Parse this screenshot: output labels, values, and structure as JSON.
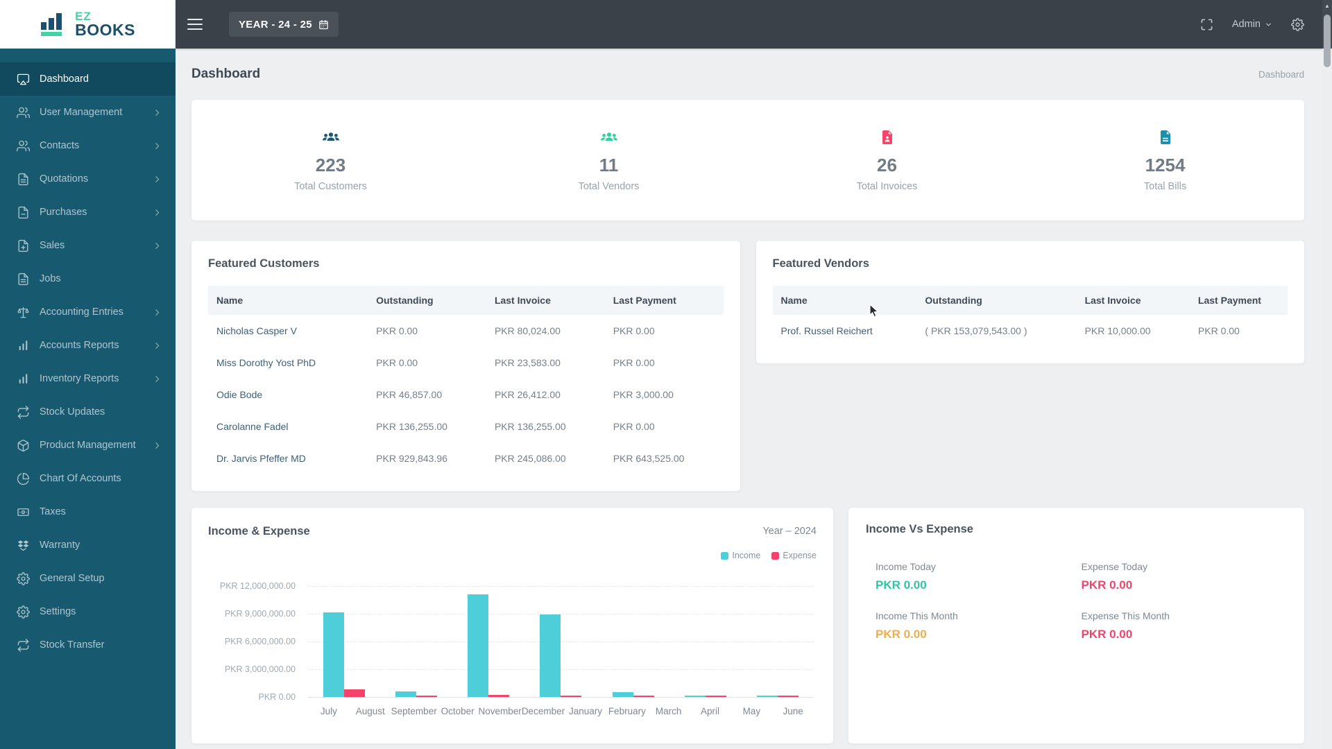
{
  "brand": {
    "logo_top": "EZ",
    "logo_bottom": "BOOKS"
  },
  "topbar": {
    "year_selector_label": "YEAR - 24 - 25",
    "user_menu_label": "Admin"
  },
  "page": {
    "title": "Dashboard",
    "breadcrumb": "Dashboard"
  },
  "sidebar": {
    "items": [
      {
        "label": "Dashboard",
        "icon": "monitor",
        "chevron": false,
        "active": true
      },
      {
        "label": "User Management",
        "icon": "users",
        "chevron": true,
        "active": false
      },
      {
        "label": "Contacts",
        "icon": "users",
        "chevron": true,
        "active": false
      },
      {
        "label": "Quotations",
        "icon": "file-text",
        "chevron": true,
        "active": false
      },
      {
        "label": "Purchases",
        "icon": "file-minus",
        "chevron": true,
        "active": false
      },
      {
        "label": "Sales",
        "icon": "file-plus",
        "chevron": true,
        "active": false
      },
      {
        "label": "Jobs",
        "icon": "file-text",
        "chevron": false,
        "active": false
      },
      {
        "label": "Accounting Entries",
        "icon": "scale",
        "chevron": true,
        "active": false
      },
      {
        "label": "Accounts Reports",
        "icon": "bar-chart",
        "chevron": true,
        "active": false
      },
      {
        "label": "Inventory Reports",
        "icon": "bar-chart",
        "chevron": true,
        "active": false
      },
      {
        "label": "Stock Updates",
        "icon": "repeat",
        "chevron": false,
        "active": false
      },
      {
        "label": "Product Management",
        "icon": "package",
        "chevron": true,
        "active": false
      },
      {
        "label": "Chart Of Accounts",
        "icon": "pie-chart",
        "chevron": false,
        "active": false
      },
      {
        "label": "Taxes",
        "icon": "banknote",
        "chevron": false,
        "active": false
      },
      {
        "label": "Warranty",
        "icon": "warranty",
        "chevron": false,
        "active": false
      },
      {
        "label": "General Setup",
        "icon": "gear",
        "chevron": false,
        "active": false
      },
      {
        "label": "Settings",
        "icon": "gear",
        "chevron": false,
        "active": false
      },
      {
        "label": "Stock Transfer",
        "icon": "repeat",
        "chevron": false,
        "active": false
      }
    ]
  },
  "stats": [
    {
      "value": "223",
      "label": "Total Customers",
      "icon": "people",
      "color": "#1C5A72"
    },
    {
      "value": "11",
      "label": "Total Vendors",
      "icon": "people",
      "color": "#33D0A0"
    },
    {
      "value": "26",
      "label": "Total Invoices",
      "icon": "doc-person",
      "color": "#F5456B"
    },
    {
      "value": "1254",
      "label": "Total Bills",
      "icon": "doc-lines",
      "color": "#1B90AC"
    }
  ],
  "featured_customers": {
    "title": "Featured Customers",
    "columns": [
      "Name",
      "Outstanding",
      "Last Invoice",
      "Last Payment"
    ],
    "rows": [
      [
        "Nicholas Casper V",
        "PKR 0.00",
        "PKR 80,024.00",
        "PKR 0.00"
      ],
      [
        "Miss Dorothy Yost PhD",
        "PKR 0.00",
        "PKR 23,583.00",
        "PKR 0.00"
      ],
      [
        "Odie Bode",
        "PKR 46,857.00",
        "PKR 26,412.00",
        "PKR 3,000.00"
      ],
      [
        "Carolanne Fadel",
        "PKR 136,255.00",
        "PKR 136,255.00",
        "PKR 0.00"
      ],
      [
        "Dr. Jarvis Pfeffer MD",
        "PKR 929,843.96",
        "PKR 245,086.00",
        "PKR 643,525.00"
      ]
    ]
  },
  "featured_vendors": {
    "title": "Featured Vendors",
    "columns": [
      "Name",
      "Outstanding",
      "Last Invoice",
      "Last Payment"
    ],
    "rows": [
      [
        "Prof. Russel Reichert",
        "( PKR 153,079,543.00 )",
        "PKR 10,000.00",
        "PKR 0.00"
      ]
    ]
  },
  "chart_data": {
    "type": "bar",
    "title": "Income & Expense",
    "period_label": "Year – 2024",
    "legend_position": "top-right",
    "grid": "dashed-horizontal",
    "x_tick_labels": [
      "July",
      "August",
      "September",
      "October",
      "November",
      "December",
      "January",
      "February",
      "March",
      "April",
      "May",
      "June"
    ],
    "y_tick_labels": [
      "PKR 12,000,000.00",
      "PKR 9,000,000.00",
      "PKR 6,000,000.00",
      "PKR 3,000,000.00",
      "PKR 0.00"
    ],
    "ylim": [
      0,
      12000000
    ],
    "series": [
      {
        "name": "Income",
        "color": "#4DCED8",
        "values": [
          9150000,
          600000,
          11100000,
          8900000,
          500000,
          100000,
          100000
        ]
      },
      {
        "name": "Expense",
        "color": "#F5426B",
        "values": [
          850000,
          150000,
          250000,
          150000,
          100000,
          100000,
          100000
        ]
      }
    ]
  },
  "income_vs_expense": {
    "title": "Income Vs Expense",
    "items": [
      {
        "label": "Income Today",
        "value": "PKR 0.00",
        "color": "#2EC5A7"
      },
      {
        "label": "Expense Today",
        "value": "PKR 0.00",
        "color": "#F5426B"
      },
      {
        "label": "Income This Month",
        "value": "PKR 0.00",
        "color": "#EFAE4E"
      },
      {
        "label": "Expense This Month",
        "value": "PKR 0.00",
        "color": "#F5426B"
      }
    ]
  }
}
